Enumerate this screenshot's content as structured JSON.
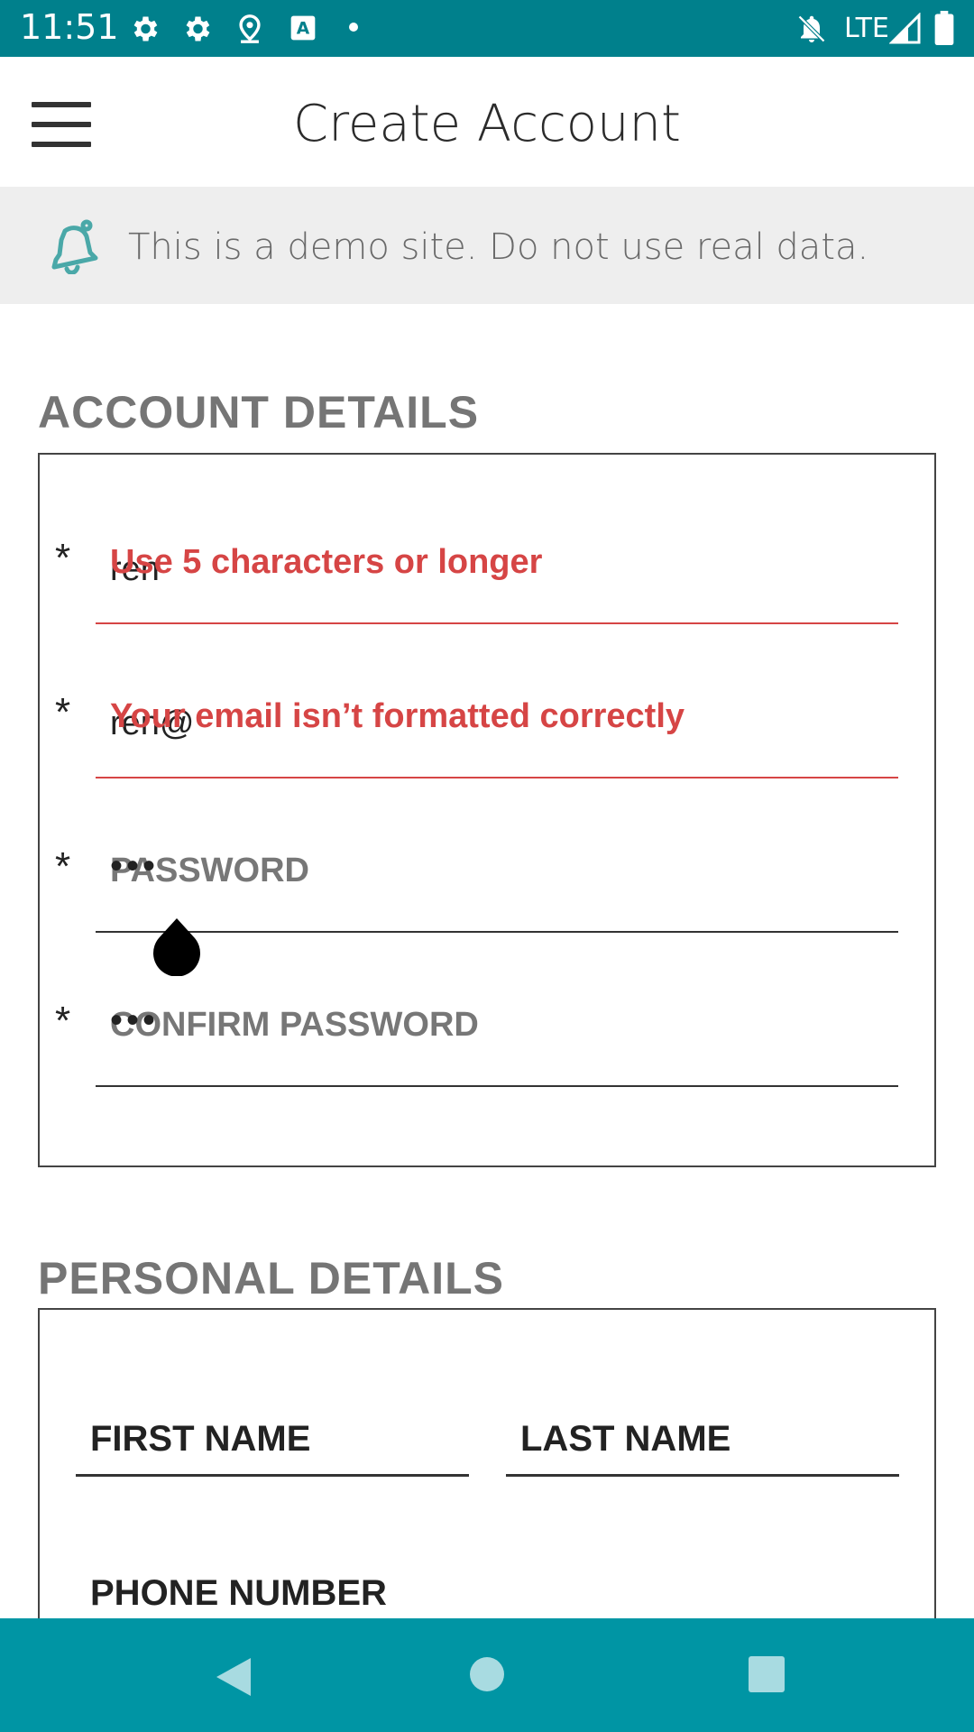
{
  "status_bar": {
    "time": "11:51",
    "network": "LTE",
    "icons": [
      "settings-icon",
      "settings-icon",
      "location-icon",
      "text-app-icon",
      "dot-icon",
      "notifications-off-icon",
      "signal-icon",
      "battery-icon"
    ]
  },
  "app_bar": {
    "title": "Create Account"
  },
  "banner": {
    "text": "This is a demo site. Do not use real data.",
    "icon": "bell-icon"
  },
  "account_details": {
    "title": "ACCOUNT DETAILS",
    "username": {
      "value": "ren",
      "error": "Use 5 characters or longer"
    },
    "email": {
      "value": "ren@",
      "error": "Your email isn’t formatted correctly"
    },
    "password": {
      "label": "PASSWORD",
      "masked_value": "•••"
    },
    "confirm_password": {
      "label": "CONFIRM PASSWORD",
      "masked_value": "•••"
    },
    "required_marker": "*"
  },
  "personal_details": {
    "title": "PERSONAL DETAILS",
    "first_name_label": "FIRST NAME",
    "last_name_label": "LAST NAME",
    "phone_label": "PHONE NUMBER"
  },
  "colors": {
    "status_bar": "#00808c",
    "nav_bar": "#0095a4",
    "error": "#d64545",
    "accent_icon": "#4aa8a8"
  }
}
